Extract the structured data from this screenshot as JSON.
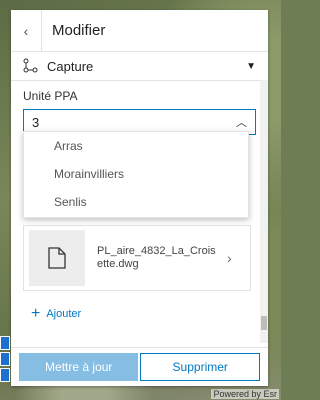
{
  "panel": {
    "title": "Modifier",
    "capture_label": "Capture",
    "field_label": "Unité PPA",
    "field_value": "3",
    "options": [
      "Arras",
      "Morainvilliers",
      "Senlis"
    ],
    "attachment_name": "PL_aire_4832_La_Croisette.dwg",
    "add_label": "Ajouter",
    "update_label": "Mettre à jour",
    "delete_label": "Supprimer"
  },
  "map": {
    "attribution": "Powered by Esr"
  },
  "colors": {
    "accent": "#0079c1",
    "primary_disabled": "#86bde3"
  },
  "icons": {
    "back": "chevron-left-icon",
    "capture": "capture-icon",
    "dropdown": "caret-down-icon",
    "input": "chevron-up-icon",
    "file": "file-icon",
    "file_nav": "chevron-right-icon",
    "add": "plus-icon"
  }
}
